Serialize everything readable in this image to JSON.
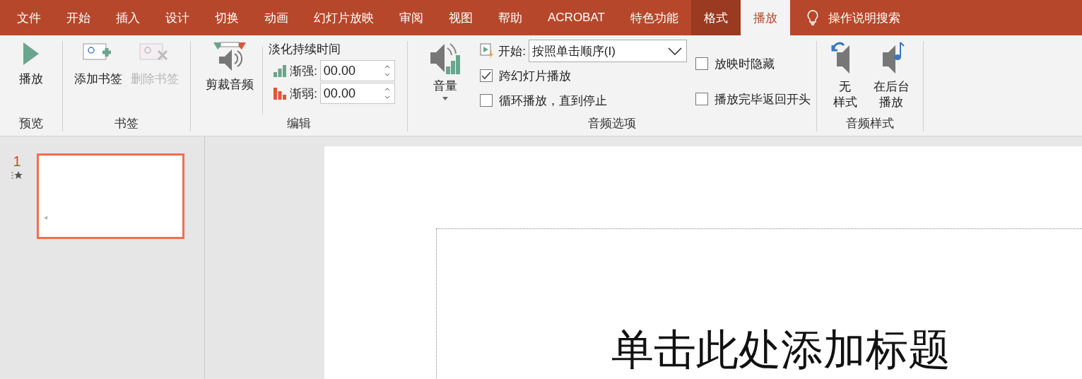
{
  "tabs": [
    {
      "label": "文件",
      "selected": false,
      "contextual": false
    },
    {
      "label": "开始",
      "selected": false,
      "contextual": false
    },
    {
      "label": "插入",
      "selected": false,
      "contextual": false
    },
    {
      "label": "设计",
      "selected": false,
      "contextual": false
    },
    {
      "label": "切换",
      "selected": false,
      "contextual": false
    },
    {
      "label": "动画",
      "selected": false,
      "contextual": false
    },
    {
      "label": "幻灯片放映",
      "selected": false,
      "contextual": false
    },
    {
      "label": "审阅",
      "selected": false,
      "contextual": false
    },
    {
      "label": "视图",
      "selected": false,
      "contextual": false
    },
    {
      "label": "帮助",
      "selected": false,
      "contextual": false
    },
    {
      "label": "ACROBAT",
      "selected": false,
      "contextual": false
    },
    {
      "label": "特色功能",
      "selected": false,
      "contextual": false
    },
    {
      "label": "格式",
      "selected": false,
      "contextual": true
    },
    {
      "label": "播放",
      "selected": true,
      "contextual": true
    }
  ],
  "search": {
    "placeholder": "操作说明搜索"
  },
  "ribbon": {
    "preview": {
      "label": "预览",
      "play_button": "播放"
    },
    "bookmarks": {
      "label": "书签",
      "buttons": [
        {
          "label": "添加书签",
          "disabled": false
        },
        {
          "label": "删除书签",
          "disabled": true
        }
      ]
    },
    "editing": {
      "label": "编辑",
      "trim_button": "剪裁音频",
      "fade_title": "淡化持续时间",
      "fade_in": {
        "label": "渐强:",
        "value": "00.00"
      },
      "fade_out": {
        "label": "渐弱:",
        "value": "00.00"
      }
    },
    "audio_options": {
      "label": "音频选项",
      "volume_button": "音量",
      "start": {
        "label": "开始:",
        "value": "按照单击顺序(I)"
      },
      "options_left": [
        {
          "label": "跨幻灯片播放",
          "checked": true
        },
        {
          "label": "循环播放，直到停止",
          "checked": false
        }
      ],
      "options_right": [
        {
          "label": "放映时隐藏",
          "checked": false
        },
        {
          "label": "播放完毕返回开头",
          "checked": false
        }
      ]
    },
    "audio_styles": {
      "label": "音频样式",
      "buttons": [
        {
          "lines": [
            "无",
            "样式"
          ]
        },
        {
          "lines": [
            "在后台",
            "播放"
          ]
        }
      ]
    }
  },
  "slides": [
    {
      "number": "1",
      "selected": true
    }
  ],
  "slide": {
    "title_placeholder": "单击此处添加标题"
  }
}
